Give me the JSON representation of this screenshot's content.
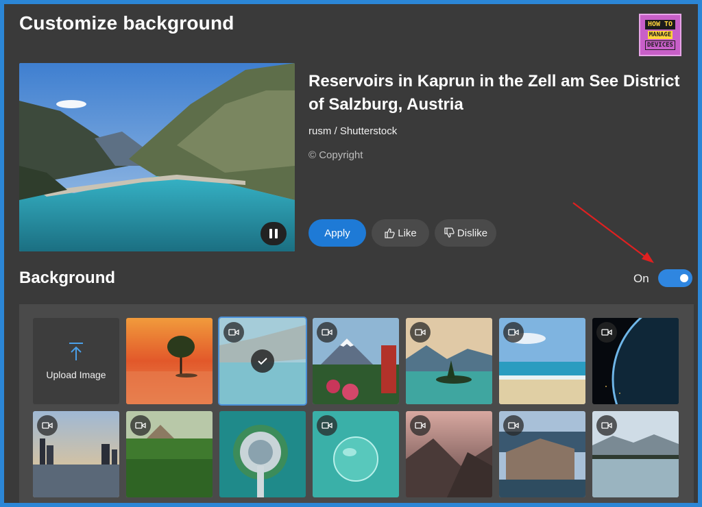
{
  "window": {
    "title": "Customize background"
  },
  "logo": {
    "line1": "HOW TO",
    "line2": "MANAGE",
    "line3": "DEVICES"
  },
  "preview": {
    "title": "Reservoirs in Kaprun in the Zell am See District of Salzburg, Austria",
    "credit": "rusm / Shutterstock",
    "copyright": "© Copyright",
    "pause_icon": "pause-icon"
  },
  "actions": {
    "apply": "Apply",
    "like": "Like",
    "dislike": "Dislike"
  },
  "background": {
    "title": "Background",
    "toggle_label": "On",
    "toggle_on": true
  },
  "upload": {
    "label": "Upload Image",
    "icon": "upload-icon"
  },
  "tiles": [
    {
      "name": "sunset-tree",
      "video": false,
      "selected": false
    },
    {
      "name": "reservoir-lake",
      "video": true,
      "selected": true
    },
    {
      "name": "mount-fuji",
      "video": true,
      "selected": false
    },
    {
      "name": "island-lake",
      "video": true,
      "selected": false
    },
    {
      "name": "beach",
      "video": true,
      "selected": false
    },
    {
      "name": "earth-space",
      "video": true,
      "selected": false
    },
    {
      "name": "city-skyline",
      "video": true,
      "selected": false
    },
    {
      "name": "green-valley",
      "video": true,
      "selected": false
    },
    {
      "name": "aerial-island",
      "video": false,
      "selected": false
    },
    {
      "name": "water-drop",
      "video": true,
      "selected": false
    },
    {
      "name": "misty-mountains",
      "video": true,
      "selected": false
    },
    {
      "name": "coastal-town",
      "video": true,
      "selected": false
    },
    {
      "name": "alpine-lake",
      "video": true,
      "selected": false
    }
  ],
  "colors": {
    "accent": "#1e7ad6",
    "panel": "#3a3a3a",
    "frame": "#2b86d6",
    "arrow": "#e02020"
  }
}
